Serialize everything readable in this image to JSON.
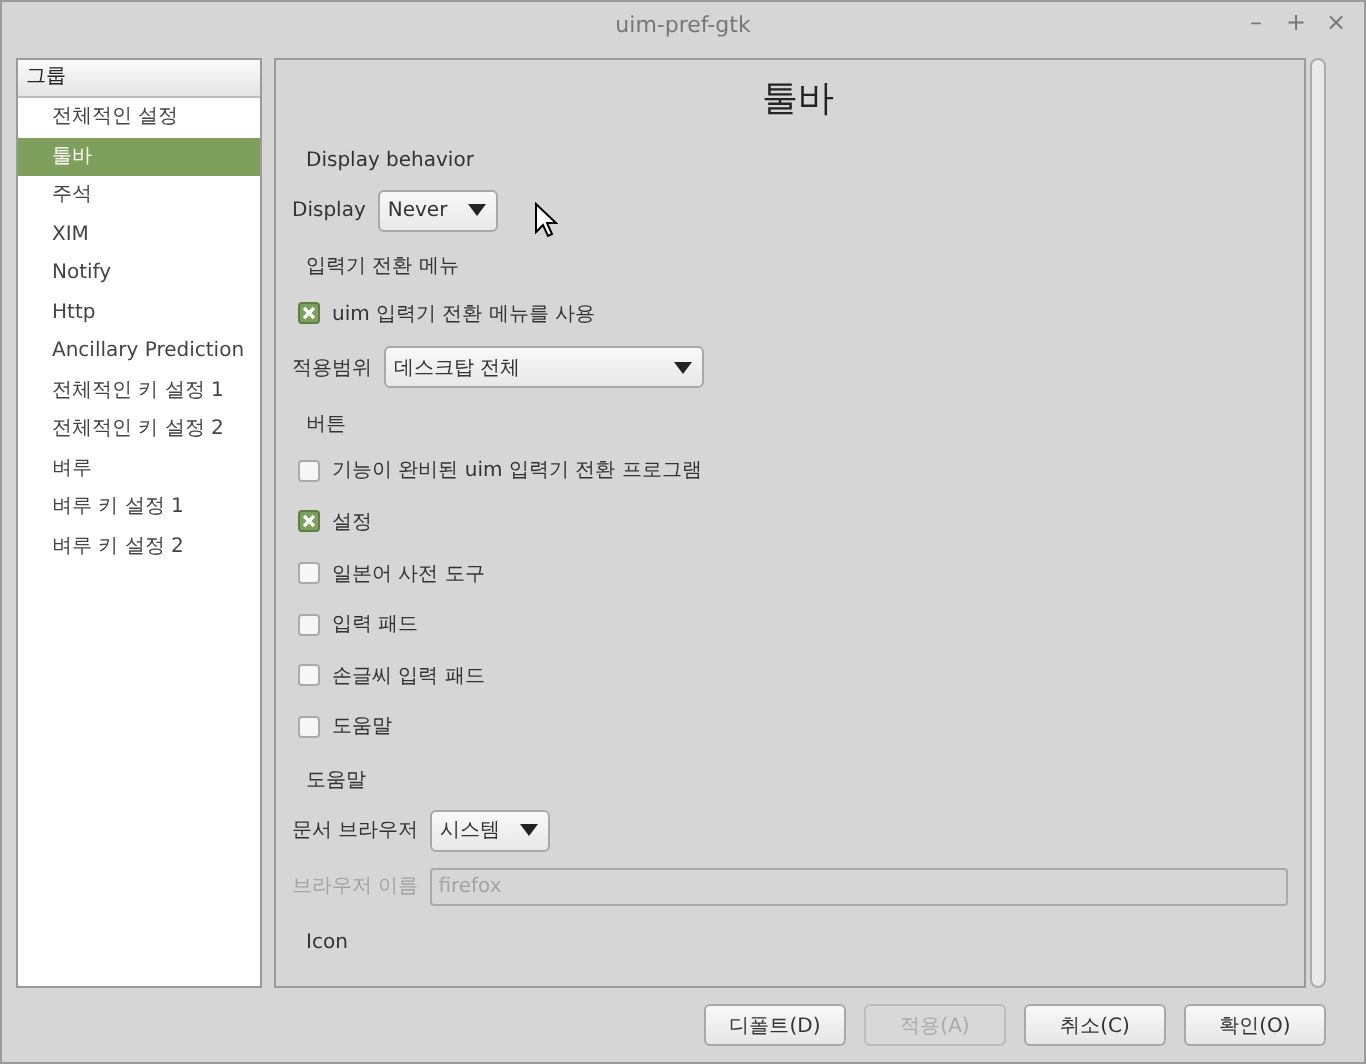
{
  "window": {
    "title": "uim-pref-gtk",
    "controls": [
      "–",
      "+",
      "×"
    ]
  },
  "sidebar": {
    "header": "그룹",
    "items": [
      {
        "label": "전체적인 설정",
        "selected": false
      },
      {
        "label": "툴바",
        "selected": true
      },
      {
        "label": "주석",
        "selected": false
      },
      {
        "label": "XIM",
        "selected": false
      },
      {
        "label": "Notify",
        "selected": false
      },
      {
        "label": "Http",
        "selected": false
      },
      {
        "label": "Ancillary Prediction",
        "selected": false
      },
      {
        "label": "전체적인 키 설정 1",
        "selected": false
      },
      {
        "label": "전체적인 키 설정 2",
        "selected": false
      },
      {
        "label": "벼루",
        "selected": false
      },
      {
        "label": "벼루 키 설정 1",
        "selected": false
      },
      {
        "label": "벼루 키 설정 2",
        "selected": false
      }
    ]
  },
  "page_title": "툴바",
  "sections": [
    {
      "heading": "Display behavior",
      "rows": [
        {
          "kind": "select",
          "label": "Display",
          "value": "Never",
          "wide": false
        }
      ]
    },
    {
      "heading": "입력기 전환 메뉴",
      "rows": [
        {
          "kind": "checkbox",
          "label": "uim 입력기 전환 메뉴를 사용",
          "checked": true
        },
        {
          "kind": "select",
          "label": "적용범위",
          "value": "데스크탑 전체",
          "wide": true
        }
      ]
    },
    {
      "heading": "버튼",
      "rows": [
        {
          "kind": "checkbox",
          "label": "기능이 완비된 uim 입력기 전환 프로그램",
          "checked": false
        },
        {
          "kind": "checkbox",
          "label": "설정",
          "checked": true
        },
        {
          "kind": "checkbox",
          "label": "일본어 사전 도구",
          "checked": false
        },
        {
          "kind": "checkbox",
          "label": "입력 패드",
          "checked": false
        },
        {
          "kind": "checkbox",
          "label": "손글씨 입력 패드",
          "checked": false
        },
        {
          "kind": "checkbox",
          "label": "도움말",
          "checked": false
        }
      ]
    },
    {
      "heading": "도움말",
      "rows": [
        {
          "kind": "select",
          "label": "문서 브라우저",
          "value": "시스템",
          "wide": false
        },
        {
          "kind": "text",
          "label": "브라우저 이름",
          "value": "firefox",
          "disabled": true
        }
      ]
    },
    {
      "heading": "Icon"
    }
  ],
  "buttons": [
    {
      "label": "디폴트(D)",
      "disabled": false
    },
    {
      "label": "적용(A)",
      "disabled": true
    },
    {
      "label": "취소(C)",
      "disabled": false
    },
    {
      "label": "확인(O)",
      "disabled": false
    }
  ]
}
